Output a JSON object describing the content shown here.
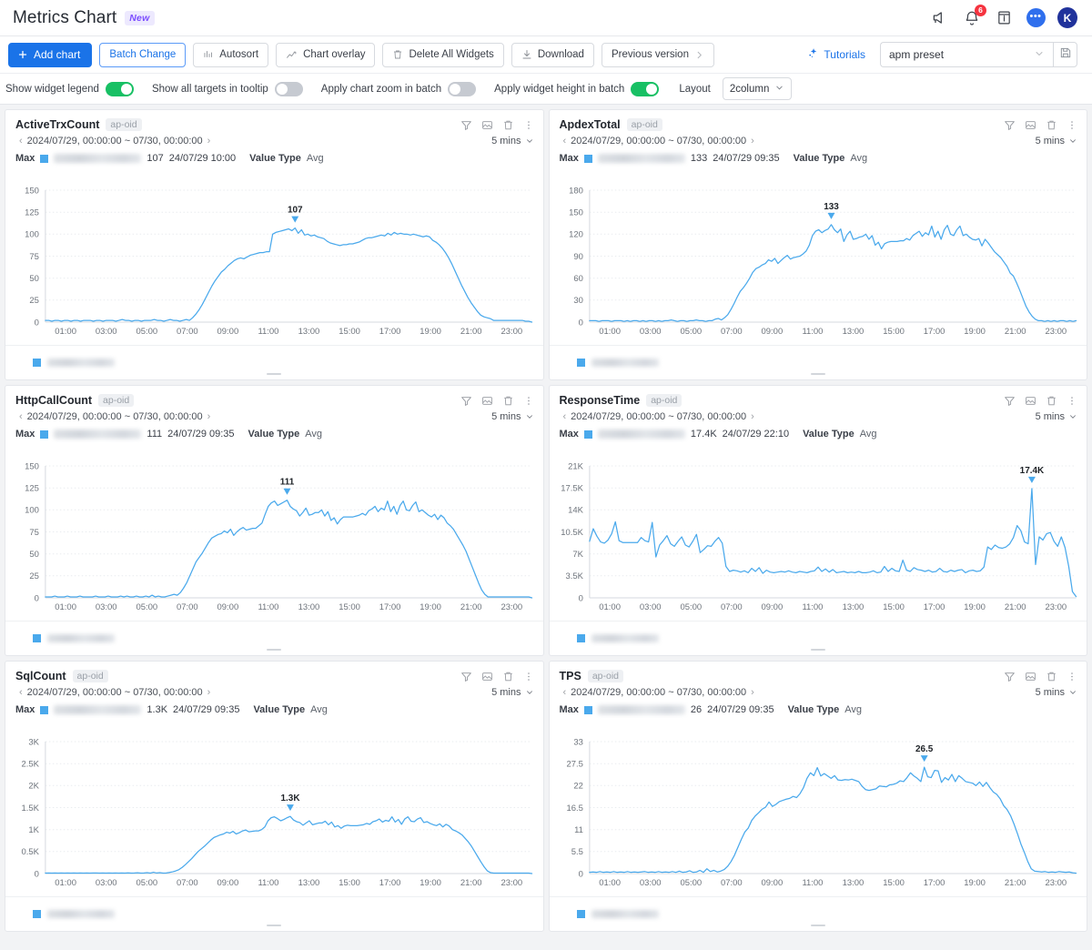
{
  "header": {
    "title": "Metrics Chart",
    "new_badge": "New",
    "icons": [
      "megaphone-icon",
      "bell-icon",
      "info-box-icon",
      "chat-icon",
      "avatar"
    ],
    "notification_count": "6",
    "avatar_initial": "K"
  },
  "toolbar": {
    "add_chart": "Add chart",
    "batch_change": "Batch Change",
    "autosort": "Autosort",
    "chart_overlay": "Chart overlay",
    "delete_all_widgets": "Delete All Widgets",
    "download": "Download",
    "previous_version": "Previous version",
    "tutorials": "Tutorials",
    "preset_value": "apm preset",
    "save_icon": "floppy-disk-icon"
  },
  "options": {
    "show_widget_legend": {
      "label": "Show widget legend",
      "on": true
    },
    "show_all_targets": {
      "label": "Show all targets in tooltip",
      "on": false
    },
    "apply_chart_zoom": {
      "label": "Apply chart zoom in batch",
      "on": false
    },
    "apply_widget_height": {
      "label": "Apply widget height in batch",
      "on": true
    },
    "layout_label": "Layout",
    "layout_value": "2column"
  },
  "widget_common": {
    "tag": "ap-oid",
    "range": "2024/07/29, 00:00:00 ~ 07/30, 00:00:00",
    "interval": "5 mins",
    "max_label": "Max",
    "value_type_label": "Value Type",
    "value_type": "Avg",
    "icons": [
      "filter-icon",
      "image-export-icon",
      "trash-icon",
      "kebab-menu-icon"
    ]
  },
  "chart_data": [
    {
      "type": "line",
      "title": "ActiveTrxCount",
      "tag": "ap-oid",
      "series_color": "#4aa9ec",
      "max_value": "107",
      "max_time": "24/07/29 10:00",
      "peak_label": "107",
      "peak_x": "10:00",
      "xlabel": "",
      "ylabel": "",
      "ylim": [
        0,
        150
      ],
      "yticks": [
        "0",
        "25",
        "50",
        "75",
        "100",
        "125",
        "150"
      ],
      "xticks": [
        "01:00",
        "03:00",
        "05:00",
        "07:00",
        "09:00",
        "11:00",
        "13:00",
        "15:00",
        "17:00",
        "19:00",
        "21:00",
        "23:00"
      ],
      "grid": true,
      "values": [
        2,
        2,
        1,
        2,
        2,
        1,
        2,
        2,
        1,
        2,
        2,
        1,
        2,
        2,
        2,
        1,
        2,
        2,
        1,
        2,
        2,
        2,
        1,
        2,
        3,
        2,
        2,
        1,
        2,
        2,
        1,
        2,
        2,
        2,
        3,
        2,
        2,
        1,
        2,
        3,
        2,
        2,
        1,
        2,
        3,
        2,
        5,
        9,
        14,
        20,
        27,
        34,
        41,
        47,
        52,
        57,
        60,
        64,
        67,
        70,
        72,
        73,
        72,
        74,
        76,
        77,
        78,
        79,
        79,
        80,
        80,
        100,
        102,
        103,
        104,
        105,
        106,
        104,
        107,
        101,
        105,
        99,
        100,
        98,
        99,
        97,
        96,
        95,
        92,
        90,
        89,
        88,
        87,
        88,
        88,
        89,
        89,
        90,
        91,
        93,
        95,
        96,
        96,
        97,
        98,
        99,
        98,
        101,
        99,
        102,
        100,
        101,
        100,
        100,
        99,
        100,
        99,
        98,
        97,
        98,
        97,
        93,
        91,
        88,
        84,
        79,
        73,
        66,
        58,
        50,
        42,
        35,
        28,
        22,
        17,
        12,
        8,
        6,
        5,
        4,
        2,
        2,
        2,
        2,
        2,
        2,
        2,
        2,
        2,
        2,
        1,
        1,
        0
      ]
    },
    {
      "type": "line",
      "title": "ApdexTotal",
      "tag": "ap-oid",
      "series_color": "#4aa9ec",
      "max_value": "133",
      "max_time": "24/07/29 09:35",
      "peak_label": "133",
      "peak_x": "09:35",
      "xlabel": "",
      "ylabel": "",
      "ylim": [
        0,
        180
      ],
      "yticks": [
        "0",
        "30",
        "60",
        "90",
        "120",
        "150",
        "180"
      ],
      "xticks": [
        "01:00",
        "03:00",
        "05:00",
        "07:00",
        "09:00",
        "11:00",
        "13:00",
        "15:00",
        "17:00",
        "19:00",
        "21:00",
        "23:00"
      ],
      "grid": true,
      "values": [
        2,
        2,
        2,
        1,
        2,
        2,
        2,
        1,
        2,
        2,
        2,
        1,
        2,
        1,
        2,
        2,
        1,
        2,
        1,
        2,
        2,
        1,
        2,
        1,
        2,
        2,
        3,
        2,
        1,
        2,
        2,
        1,
        2,
        2,
        3,
        2,
        2,
        1,
        2,
        2,
        4,
        5,
        3,
        6,
        10,
        17,
        25,
        34,
        42,
        47,
        53,
        60,
        68,
        73,
        75,
        78,
        80,
        85,
        83,
        87,
        80,
        84,
        88,
        91,
        86,
        88,
        89,
        90,
        93,
        97,
        105,
        118,
        124,
        126,
        122,
        125,
        127,
        133,
        126,
        122,
        127,
        110,
        119,
        124,
        113,
        114,
        116,
        117,
        120,
        113,
        118,
        105,
        109,
        100,
        107,
        109,
        110,
        110,
        110,
        111,
        111,
        114,
        112,
        118,
        121,
        124,
        117,
        122,
        119,
        131,
        116,
        124,
        113,
        126,
        132,
        120,
        118,
        126,
        131,
        118,
        120,
        116,
        113,
        112,
        114,
        104,
        113,
        108,
        102,
        96,
        92,
        88,
        82,
        76,
        67,
        63,
        54,
        44,
        33,
        22,
        14,
        8,
        4,
        2,
        2,
        1,
        2,
        1,
        2,
        1,
        2,
        2,
        1,
        2,
        1,
        2
      ]
    },
    {
      "type": "line",
      "title": "HttpCallCount",
      "tag": "ap-oid",
      "series_color": "#4aa9ec",
      "max_value": "111",
      "max_time": "24/07/29 09:35",
      "peak_label": "111",
      "peak_x": "09:35",
      "xlabel": "",
      "ylabel": "",
      "ylim": [
        0,
        150
      ],
      "yticks": [
        "0",
        "25",
        "50",
        "75",
        "100",
        "125",
        "150"
      ],
      "xticks": [
        "01:00",
        "03:00",
        "05:00",
        "07:00",
        "09:00",
        "11:00",
        "13:00",
        "15:00",
        "17:00",
        "19:00",
        "21:00",
        "23:00"
      ],
      "grid": true,
      "values": [
        1,
        1,
        1,
        2,
        1,
        1,
        1,
        2,
        1,
        1,
        1,
        2,
        1,
        1,
        1,
        1,
        2,
        1,
        1,
        1,
        2,
        1,
        1,
        1,
        2,
        1,
        2,
        1,
        1,
        2,
        1,
        1,
        2,
        1,
        3,
        1,
        2,
        1,
        1,
        2,
        3,
        4,
        3,
        6,
        11,
        17,
        25,
        33,
        41,
        46,
        51,
        57,
        63,
        68,
        70,
        72,
        73,
        76,
        74,
        78,
        71,
        75,
        78,
        80,
        77,
        78,
        79,
        79,
        82,
        85,
        95,
        104,
        108,
        110,
        105,
        107,
        109,
        111,
        104,
        101,
        99,
        93,
        97,
        102,
        94,
        95,
        97,
        97,
        100,
        93,
        98,
        88,
        91,
        84,
        89,
        92,
        92,
        92,
        92,
        93,
        94,
        96,
        94,
        99,
        101,
        104,
        98,
        102,
        100,
        110,
        98,
        104,
        95,
        105,
        110,
        100,
        99,
        105,
        109,
        98,
        100,
        97,
        94,
        92,
        95,
        89,
        94,
        91,
        85,
        82,
        78,
        72,
        66,
        60,
        53,
        44,
        35,
        26,
        17,
        9,
        4,
        1,
        1,
        1,
        1,
        1,
        1,
        1,
        1,
        1,
        1,
        1,
        1,
        1,
        1,
        0
      ]
    },
    {
      "type": "line",
      "title": "ResponseTime",
      "tag": "ap-oid",
      "series_color": "#4aa9ec",
      "max_value": "17.4K",
      "max_time": "24/07/29 22:10",
      "peak_label": "17.4K",
      "peak_x": "22:10",
      "xlabel": "",
      "ylabel": "",
      "ylim": [
        0,
        21000
      ],
      "yticks": [
        "0",
        "3.5K",
        "7K",
        "10.5K",
        "14K",
        "17.5K",
        "21K"
      ],
      "xticks": [
        "01:00",
        "03:00",
        "05:00",
        "07:00",
        "09:00",
        "11:00",
        "13:00",
        "15:00",
        "17:00",
        "19:00",
        "21:00",
        "23:00"
      ],
      "grid": true,
      "values": [
        9000,
        11000,
        9800,
        8900,
        8700,
        9200,
        10200,
        12100,
        9100,
        8800,
        8800,
        8800,
        8800,
        8800,
        9600,
        9100,
        8900,
        12000,
        6500,
        8400,
        9100,
        9900,
        8600,
        8200,
        9000,
        9700,
        8400,
        8100,
        9000,
        10100,
        7200,
        7700,
        8300,
        8200,
        9000,
        9600,
        8700,
        5000,
        4200,
        4400,
        4300,
        4100,
        4300,
        4000,
        4700,
        4200,
        4800,
        3900,
        4400,
        4100,
        4000,
        4100,
        4200,
        4100,
        4300,
        4100,
        4000,
        4200,
        4100,
        4000,
        4200,
        4300,
        4900,
        4200,
        4600,
        4100,
        4500,
        4000,
        4100,
        4200,
        4000,
        4100,
        4000,
        4200,
        4000,
        4000,
        4100,
        4300,
        4000,
        4100,
        5000,
        4200,
        4700,
        4300,
        4200,
        6000,
        4400,
        4200,
        4800,
        4500,
        4400,
        4200,
        4400,
        4100,
        4200,
        4700,
        4200,
        4100,
        4400,
        4200,
        4400,
        4500,
        4000,
        4300,
        4400,
        4200,
        4300,
        4900,
        8100,
        7700,
        8400,
        8000,
        7900,
        8100,
        8600,
        9600,
        11500,
        10700,
        8900,
        8600,
        17400,
        5300,
        9700,
        9200,
        10200,
        10400,
        9000,
        8200,
        9700,
        8000,
        5000,
        1000,
        200
      ]
    },
    {
      "type": "line",
      "title": "SqlCount",
      "tag": "ap-oid",
      "series_color": "#4aa9ec",
      "max_value": "1.3K",
      "max_time": "24/07/29 09:35",
      "peak_label": "1.3K",
      "peak_x": "09:35",
      "xlabel": "",
      "ylabel": "",
      "ylim": [
        0,
        3000
      ],
      "yticks": [
        "0",
        "0.5K",
        "1K",
        "1.5K",
        "2K",
        "2.5K",
        "3K"
      ],
      "xticks": [
        "01:00",
        "03:00",
        "05:00",
        "07:00",
        "09:00",
        "11:00",
        "13:00",
        "15:00",
        "17:00",
        "19:00",
        "21:00",
        "23:00"
      ],
      "grid": true,
      "values": [
        10,
        12,
        10,
        14,
        10,
        12,
        10,
        14,
        10,
        12,
        10,
        14,
        10,
        12,
        10,
        12,
        14,
        10,
        12,
        10,
        14,
        10,
        12,
        10,
        14,
        10,
        16,
        10,
        12,
        18,
        10,
        12,
        20,
        10,
        30,
        12,
        20,
        10,
        14,
        25,
        40,
        60,
        90,
        140,
        200,
        270,
        340,
        420,
        500,
        560,
        620,
        690,
        760,
        820,
        850,
        880,
        900,
        940,
        920,
        960,
        900,
        930,
        970,
        990,
        950,
        960,
        970,
        970,
        1000,
        1060,
        1200,
        1270,
        1290,
        1250,
        1200,
        1230,
        1270,
        1300,
        1220,
        1180,
        1160,
        1100,
        1150,
        1200,
        1110,
        1130,
        1150,
        1150,
        1190,
        1110,
        1170,
        1060,
        1090,
        1030,
        1080,
        1100,
        1090,
        1090,
        1090,
        1100,
        1110,
        1140,
        1120,
        1180,
        1200,
        1240,
        1170,
        1210,
        1190,
        1290,
        1170,
        1230,
        1120,
        1240,
        1290,
        1190,
        1180,
        1240,
        1270,
        1160,
        1180,
        1140,
        1110,
        1090,
        1130,
        1060,
        1120,
        1080,
        1000,
        970,
        930,
        880,
        800,
        720,
        620,
        500,
        380,
        260,
        150,
        60,
        20,
        10,
        10,
        10,
        10,
        10,
        10,
        10,
        10,
        10,
        10,
        10,
        10,
        0
      ]
    },
    {
      "type": "line",
      "title": "TPS",
      "tag": "ap-oid",
      "series_color": "#4aa9ec",
      "max_value": "26",
      "max_time": "24/07/29 09:35",
      "peak_label": "26.5",
      "peak_x": "09:35",
      "xlabel": "",
      "ylabel": "",
      "ylim": [
        0,
        33
      ],
      "yticks": [
        "0",
        "5.5",
        "11",
        "16.5",
        "22",
        "27.5",
        "33"
      ],
      "xticks": [
        "01:00",
        "03:00",
        "05:00",
        "07:00",
        "09:00",
        "11:00",
        "13:00",
        "15:00",
        "17:00",
        "19:00",
        "21:00",
        "23:00"
      ],
      "grid": true,
      "values": [
        0.3,
        0.4,
        0.3,
        0.5,
        0.3,
        0.4,
        0.3,
        0.5,
        0.3,
        0.4,
        0.3,
        0.5,
        0.3,
        0.4,
        0.3,
        0.4,
        0.5,
        0.3,
        0.4,
        0.3,
        0.5,
        0.3,
        0.4,
        0.3,
        0.5,
        0.3,
        0.6,
        0.3,
        0.4,
        0.7,
        0.3,
        0.4,
        0.8,
        0.3,
        1.2,
        0.5,
        0.8,
        0.4,
        0.6,
        1.0,
        1.8,
        3.0,
        4.6,
        6.6,
        8.6,
        10.4,
        11.4,
        13.3,
        14.4,
        15.2,
        16.1,
        16.6,
        17.9,
        16.8,
        17.3,
        18.0,
        18.3,
        18.6,
        18.8,
        19.3,
        19.0,
        20.0,
        21.5,
        23.8,
        25.2,
        24.5,
        26.5,
        24.4,
        25.0,
        24.4,
        23.8,
        24.5,
        23.4,
        23.3,
        23.5,
        23.4,
        23.6,
        23.3,
        23.0,
        21.8,
        21.0,
        20.8,
        21.0,
        21.2,
        21.9,
        21.8,
        21.7,
        22.2,
        22.3,
        22.6,
        23.2,
        23.0,
        24.0,
        25.2,
        24.4,
        23.8,
        23.0,
        26.6,
        24.2,
        24.0,
        25.8,
        25.7,
        22.8,
        24.0,
        23.4,
        24.8,
        23.0,
        24.5,
        23.8,
        23.0,
        22.8,
        22.6,
        22.0,
        22.9,
        21.8,
        22.8,
        21.5,
        20.4,
        19.8,
        18.7,
        17.0,
        16.0,
        14.5,
        12.4,
        10.0,
        7.4,
        5.3,
        3.0,
        1.2,
        0.6,
        0.5,
        0.4,
        0.5,
        0.3,
        0.4,
        0.3,
        0.5,
        0.4,
        0.3,
        0.4,
        0.2,
        0.1
      ]
    }
  ]
}
